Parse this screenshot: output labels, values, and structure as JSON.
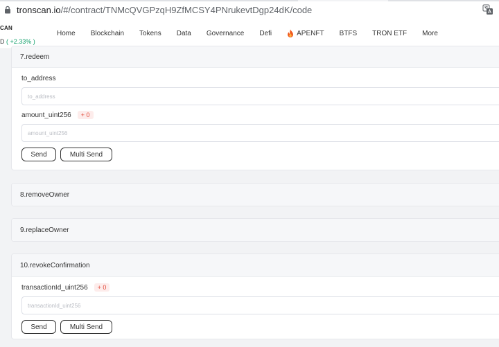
{
  "browser": {
    "url_host": "tronscan.io",
    "url_path": "/#/contract/TNMcQVGPzqH9ZfMCSY4PNrukevtDgp24dK/code"
  },
  "site": {
    "brand": "CAN",
    "price_prefix": "D",
    "price_change": "( +2.33% )",
    "nav": [
      "Home",
      "Blockchain",
      "Tokens",
      "Data",
      "Governance",
      "Defi",
      "APENFT",
      "BTFS",
      "TRON ETF",
      "More"
    ]
  },
  "functions": [
    {
      "title": "7.redeem",
      "params": [
        {
          "label": "to_address",
          "badge": null,
          "placeholder": "to_address"
        },
        {
          "label": "amount_uint256",
          "badge": "+ 0",
          "placeholder": "amount_uint256"
        }
      ],
      "send_label": "Send",
      "multi_send_label": "Multi Send"
    },
    {
      "title": "8.removeOwner"
    },
    {
      "title": "9.replaceOwner"
    },
    {
      "title": "10.revokeConfirmation",
      "params": [
        {
          "label": "transactionId_uint256",
          "badge": "+ 0",
          "placeholder": "transactionId_uint256"
        }
      ],
      "send_label": "Send",
      "multi_send_label": "Multi Send"
    }
  ],
  "colors": {
    "accent_green": "#12a06b",
    "badge_red": "#e24b3b",
    "apenft_flame": "#f05a1e"
  }
}
